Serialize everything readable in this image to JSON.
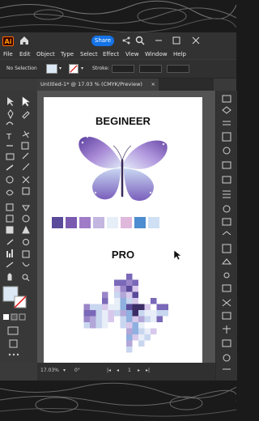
{
  "app": {
    "share_label": "Share",
    "menu": [
      "File",
      "Edit",
      "Object",
      "Type",
      "Select",
      "Effect",
      "View",
      "Window",
      "Help"
    ]
  },
  "control_bar": {
    "selection": "No Selection",
    "stroke_label": "Stroke:"
  },
  "document": {
    "tab_title": "Untitled-1* @ 17.03 % (CMYK/Preview)",
    "close_glyph": "×"
  },
  "artboard": {
    "beginner_label": "BEGINEER",
    "pro_label": "PRO",
    "palette": [
      "#5a4a9a",
      "#7a5ab0",
      "#a07cc8",
      "#c3b6e0",
      "#e6eef8",
      "#e0b8dc",
      "#4c8cd0",
      "#cfe0f4"
    ],
    "pixels": [
      [
        0,
        0,
        0,
        0,
        0,
        0,
        0,
        0,
        0,
        0,
        0,
        0,
        0,
        0,
        0,
        0,
        0,
        0,
        0,
        0,
        0
      ],
      [
        0,
        0,
        0,
        0,
        0,
        0,
        0,
        0,
        0,
        0,
        0,
        0,
        0,
        0,
        0,
        0,
        0,
        0,
        0,
        0,
        0
      ],
      [
        0,
        0,
        0,
        0,
        0,
        0,
        0,
        0,
        0,
        0,
        0,
        0,
        0,
        0,
        0,
        0,
        0,
        0,
        0,
        0,
        0
      ],
      [
        0,
        0,
        0,
        0,
        0,
        0,
        0,
        0,
        0,
        0,
        0,
        0,
        0,
        0,
        0,
        0,
        0,
        0,
        0,
        0,
        0
      ],
      [
        0,
        0,
        0,
        0,
        0,
        0,
        0,
        0,
        0,
        0,
        0,
        0,
        0,
        0,
        0,
        0,
        0,
        0,
        0,
        0,
        0
      ]
    ]
  },
  "status": {
    "zoom": "17.03%",
    "rotation": "0°",
    "page": "1"
  },
  "colors": {
    "accent": "#1473e6",
    "butterfly_dark": "#6a4fa8",
    "butterfly_light": "#c9d8f0"
  }
}
